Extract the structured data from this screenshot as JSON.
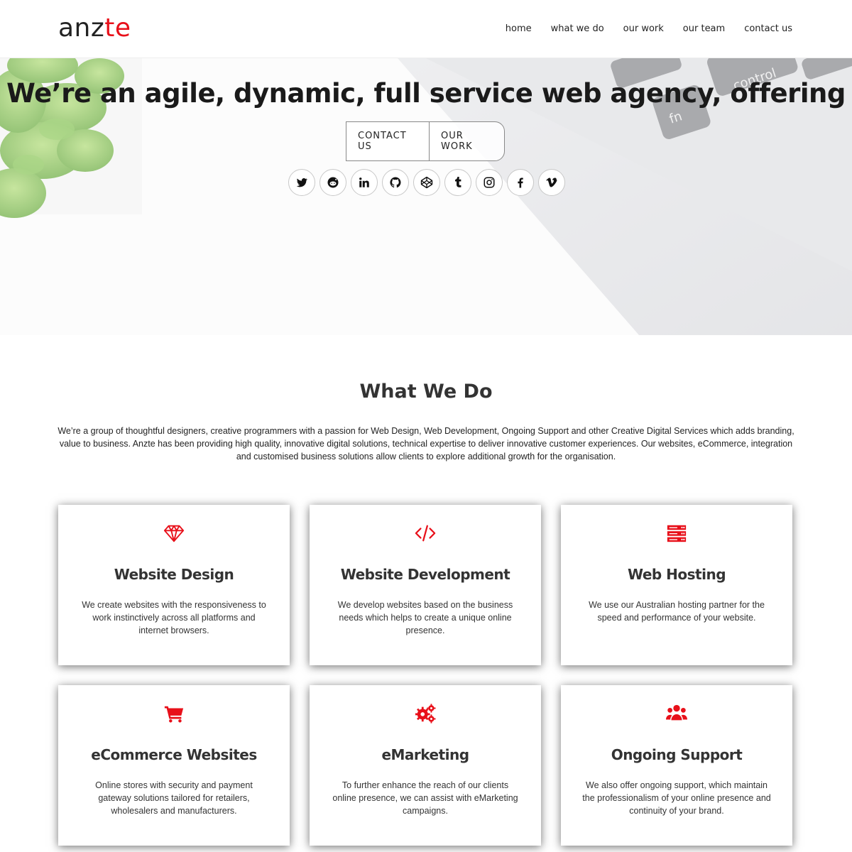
{
  "logo": {
    "part1": "anz",
    "part2": "te"
  },
  "nav": [
    {
      "label": "home"
    },
    {
      "label": "what we do"
    },
    {
      "label": "our work"
    },
    {
      "label": "our team"
    },
    {
      "label": "contact us"
    }
  ],
  "hero": {
    "title": "We’re an agile, dynamic, full service web agency, offering",
    "buttons": [
      {
        "label": "CONTACT US"
      },
      {
        "label": "OUR WORK"
      }
    ],
    "socials": [
      "twitter-icon",
      "reddit-icon",
      "linkedin-icon",
      "github-icon",
      "codepen-icon",
      "tumblr-icon",
      "instagram-icon",
      "facebook-icon",
      "vimeo-icon"
    ]
  },
  "what_we_do": {
    "title": "What We Do",
    "intro": "We’re a group of thoughtful designers, creative programmers with a passion for Web Design, Web Development, Ongoing Support and other Creative Digital Services which adds branding, value to business. Anzte has been providing high quality, innovative digital solutions, technical expertise to deliver innovative customer experiences. Our websites, eCommerce, integration and customised business solutions allow clients to explore additional growth for the organisation.",
    "accent_color": "#e8101a",
    "cards": [
      {
        "icon": "diamond-icon",
        "title": "Website Design",
        "text": "We create websites with the responsiveness to work instinctively across all platforms and internet browsers."
      },
      {
        "icon": "code-icon",
        "title": "Website Development",
        "text": "We develop websites based on the business needs which helps to create a unique online presence."
      },
      {
        "icon": "server-icon",
        "title": "Web Hosting",
        "text": "We use our Australian hosting partner for the speed and performance of your website."
      },
      {
        "icon": "cart-icon",
        "title": "eCommerce Websites",
        "text": "Online stores with security and payment gateway solutions tailored for retailers, wholesalers and manufacturers."
      },
      {
        "icon": "gears-icon",
        "title": "eMarketing",
        "text": "To further enhance the reach of our clients online presence, we can assist with eMarketing campaigns."
      },
      {
        "icon": "users-icon",
        "title": "Ongoing Support",
        "text": "We also offer ongoing support, which maintain the professionalism of your online presence and continuity of your brand."
      }
    ]
  }
}
